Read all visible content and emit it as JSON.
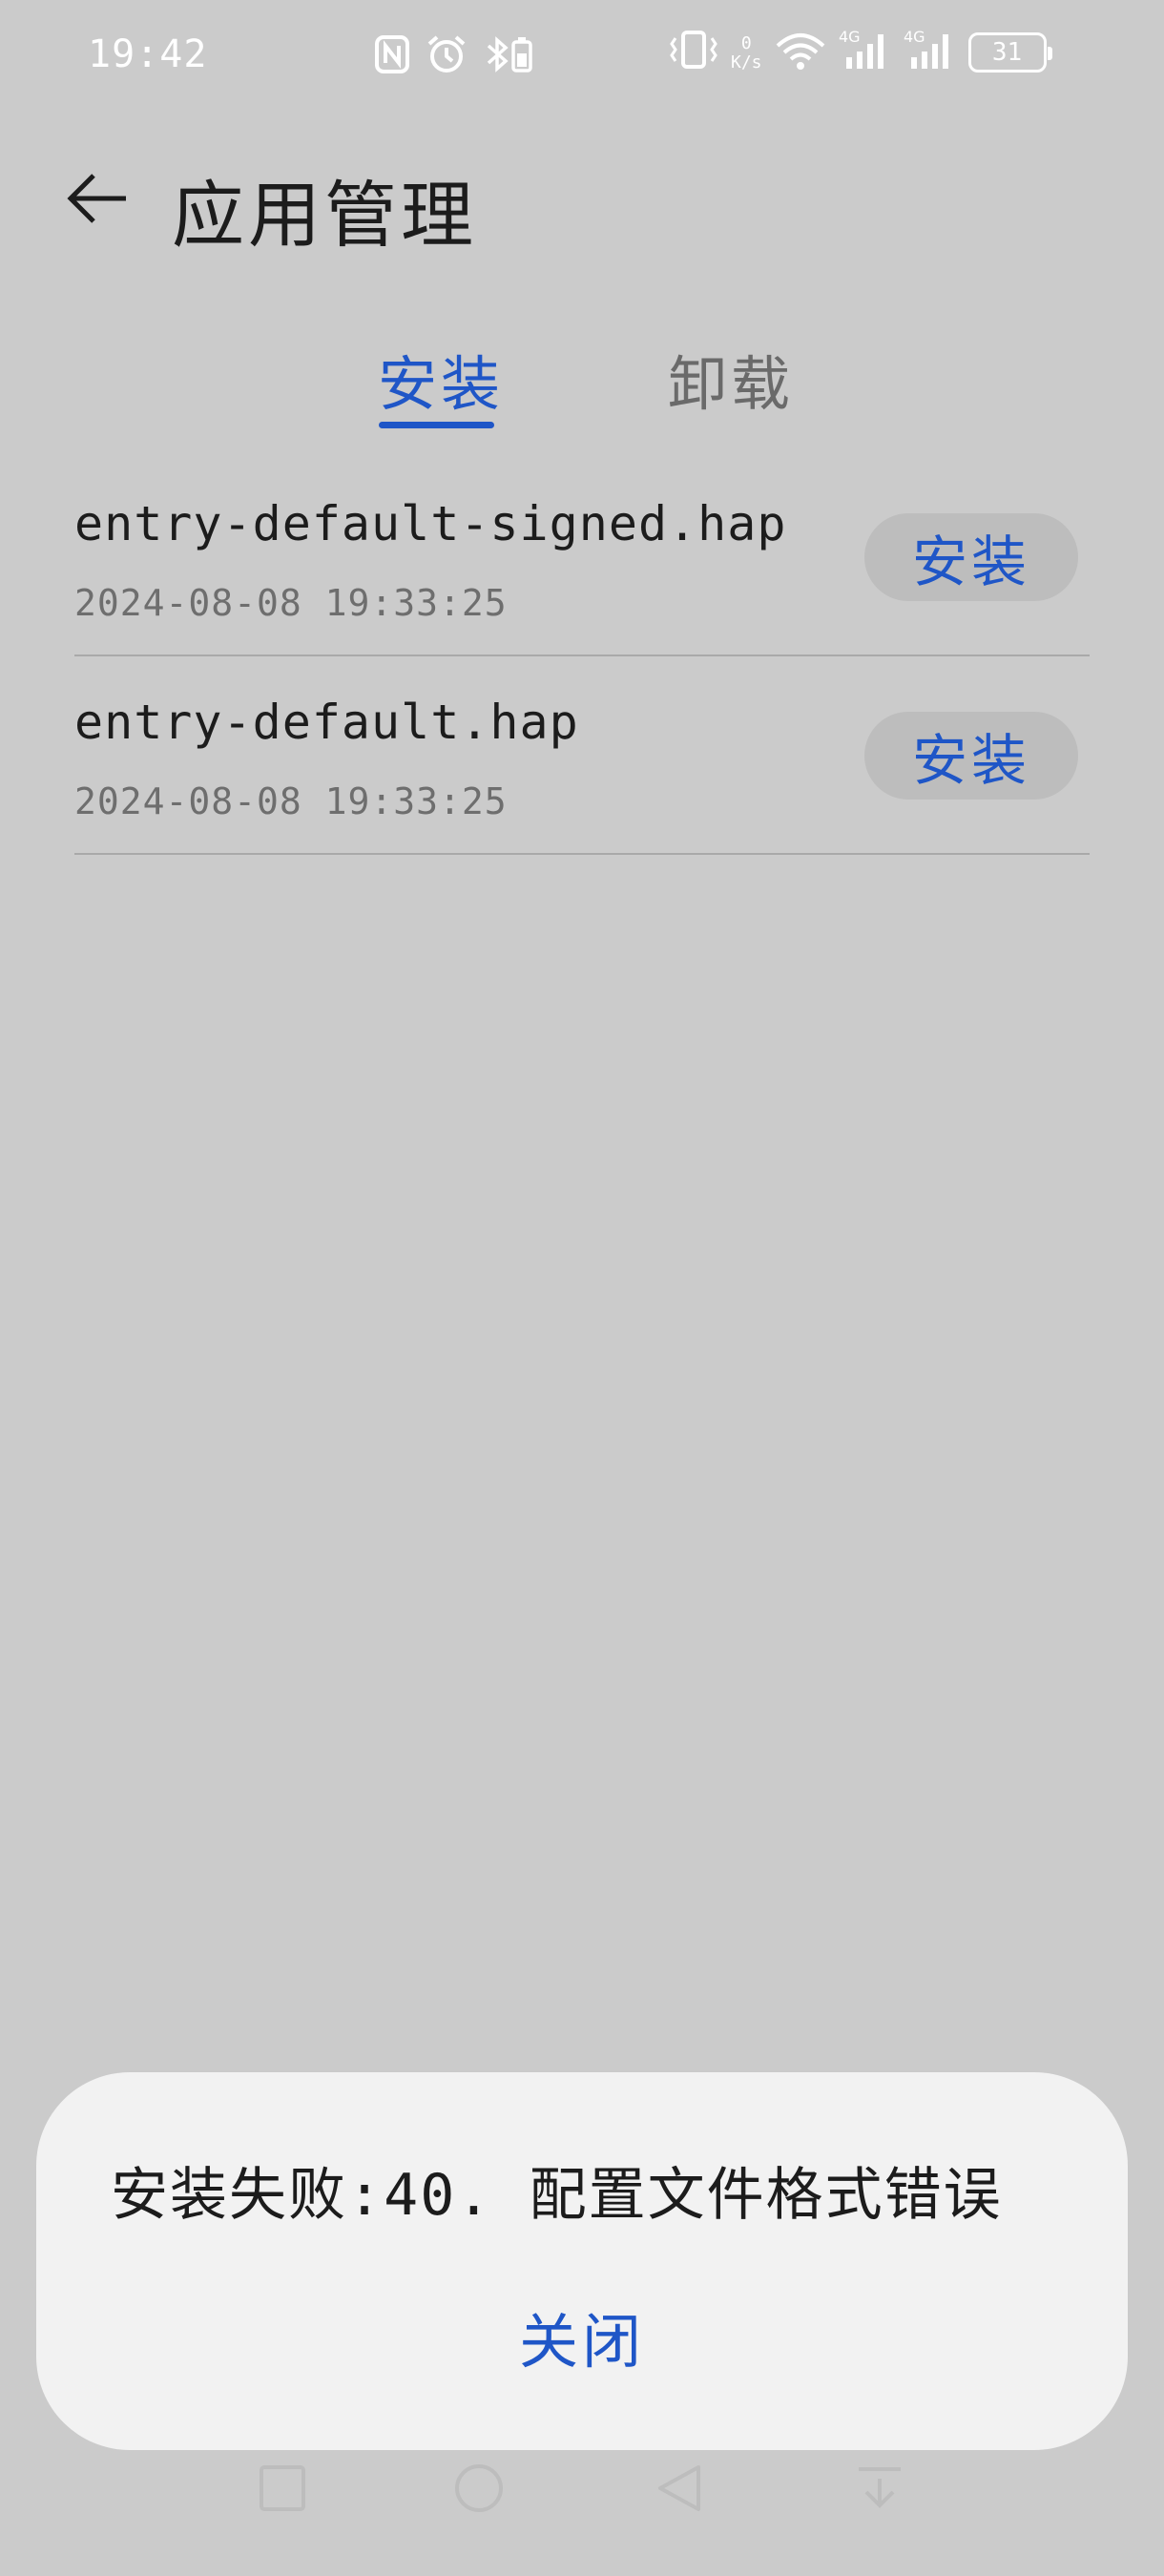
{
  "status_bar": {
    "time": "19:42",
    "network_speed_value": "0",
    "network_speed_unit": "K/s",
    "battery_level": "31",
    "icons": [
      "nfc-icon",
      "alarm-icon",
      "bluetooth-battery-icon",
      "vibrate-icon",
      "wifi-icon",
      "signal-4g-icon",
      "signal-4g-icon",
      "battery-icon"
    ]
  },
  "header": {
    "title": "应用管理",
    "back_icon": "arrow-left-icon"
  },
  "tabs": [
    {
      "label": "安装",
      "active": true
    },
    {
      "label": "卸载",
      "active": false
    }
  ],
  "files": [
    {
      "name": "entry-default-signed.hap",
      "date": "2024-08-08 19:33:25",
      "action": "安装"
    },
    {
      "name": "entry-default.hap",
      "date": "2024-08-08 19:33:25",
      "action": "安装"
    }
  ],
  "dialog": {
    "message": "安装失败:40. 配置文件格式错误",
    "close_label": "关闭"
  },
  "nav_bar": {
    "icons": [
      "recent-apps-icon",
      "home-icon",
      "back-icon",
      "notification-pulldown-icon"
    ]
  },
  "colors": {
    "accent": "#1f56c7",
    "background": "#cbcbcb",
    "dialog_background": "#f2f2f2"
  }
}
